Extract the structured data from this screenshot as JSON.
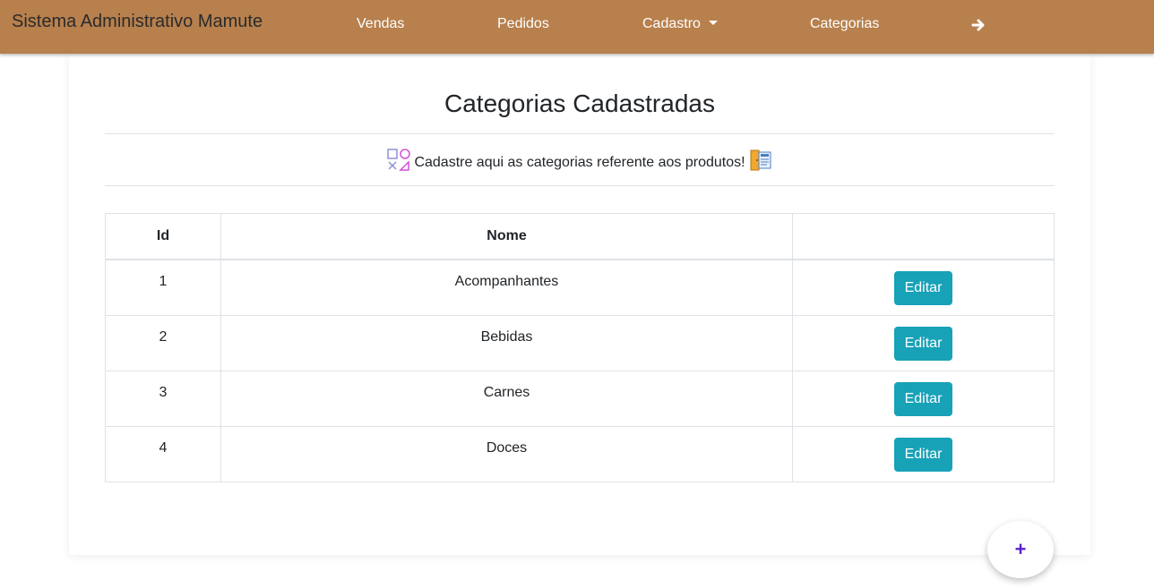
{
  "navbar": {
    "brand": "Sistema Administrativo Mamute",
    "links": [
      "Vendas",
      "Pedidos",
      "Cadastro",
      "Categorias"
    ],
    "exit_icon": "arrow-right-icon",
    "background_color": "#b7804d"
  },
  "main": {
    "title": "Categorias Cadastradas",
    "subtitle": "Cadastre aqui as categorias referente aos produtos!",
    "subtitle_icons": [
      "shapes-icon",
      "catalog-door-icon"
    ]
  },
  "table": {
    "headers": [
      "Id",
      "Nome",
      ""
    ],
    "rows": [
      {
        "id": "1",
        "nome": "Acompanhantes",
        "action": "Editar"
      },
      {
        "id": "2",
        "nome": "Bebidas",
        "action": "Editar"
      },
      {
        "id": "3",
        "nome": "Carnes",
        "action": "Editar"
      },
      {
        "id": "4",
        "nome": "Doces",
        "action": "Editar"
      }
    ]
  },
  "fab": {
    "label": "+",
    "color": "#5b1fd1"
  },
  "colors": {
    "button": "#17a2b8"
  }
}
